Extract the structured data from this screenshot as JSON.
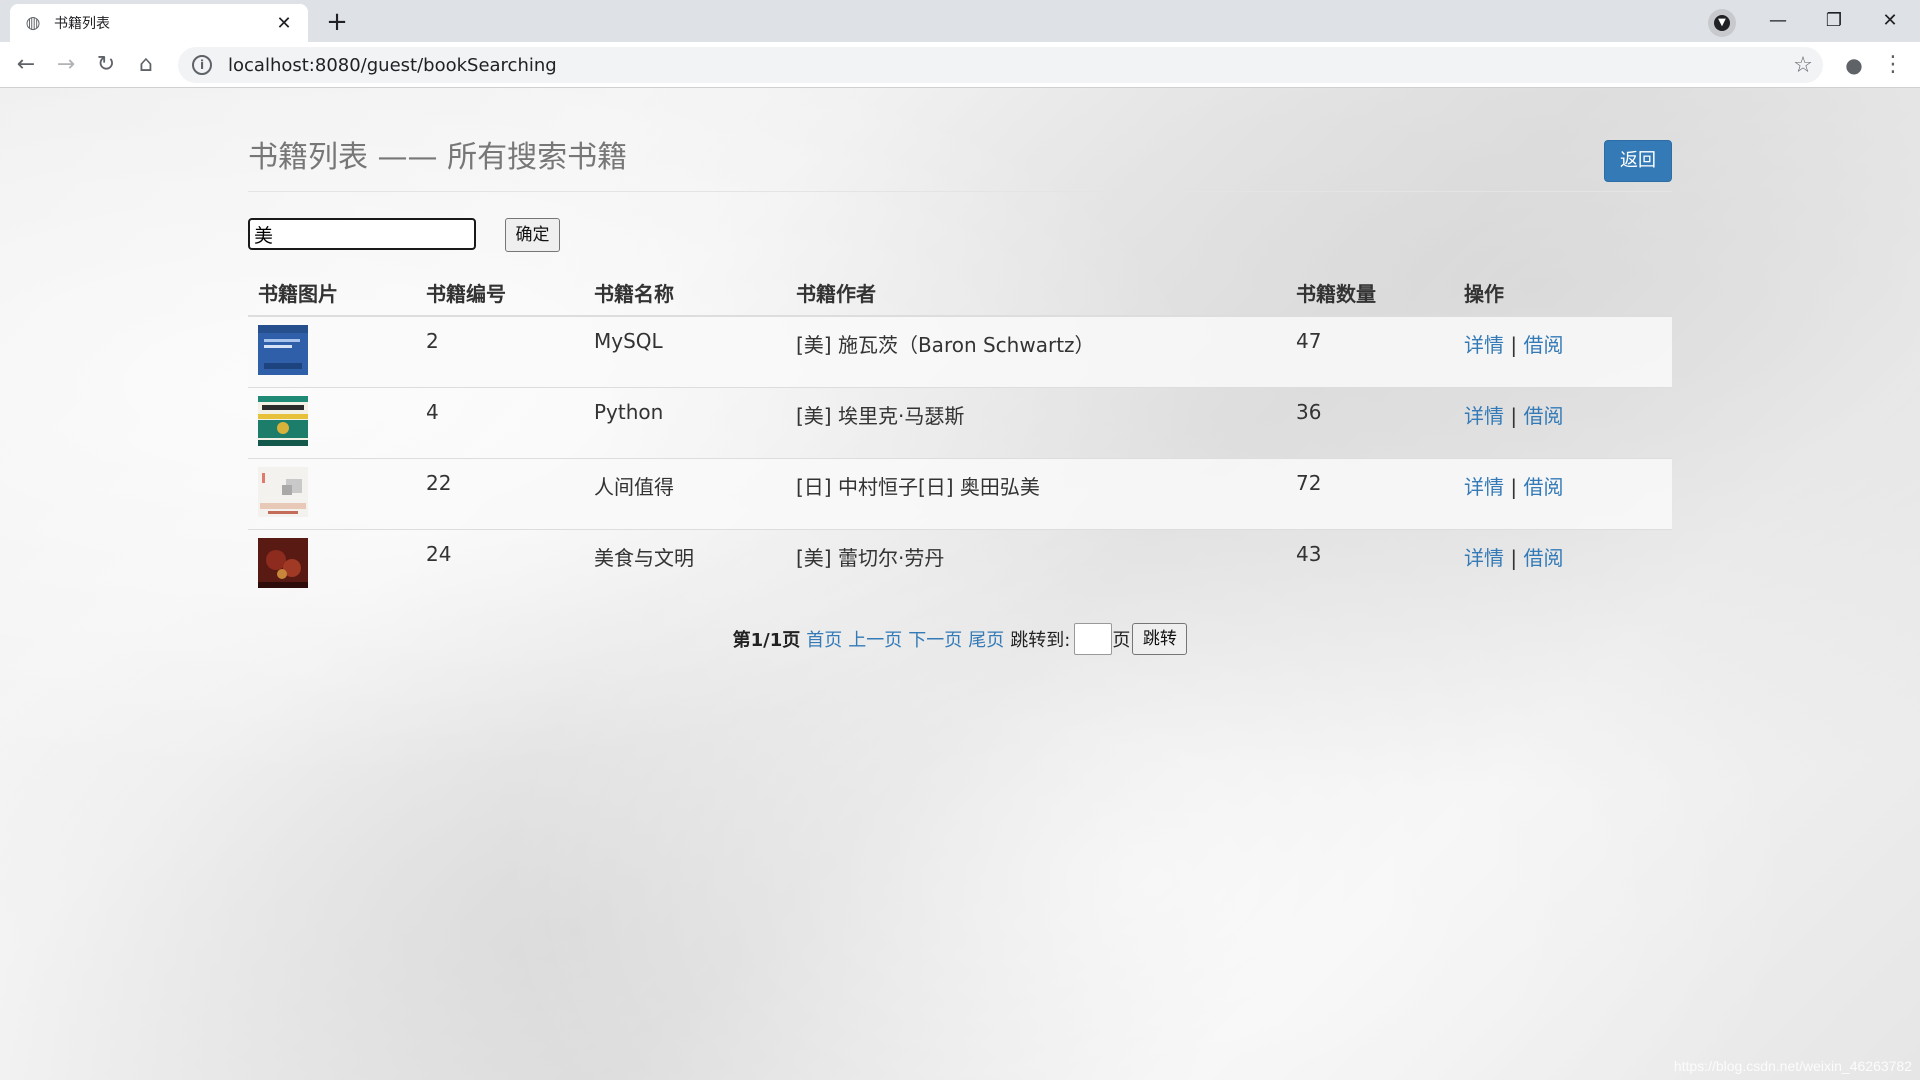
{
  "browser": {
    "tab_title": "书籍列表",
    "url": "localhost:8080/guest/bookSearching"
  },
  "header": {
    "title": "书籍列表 —— 所有搜索书籍",
    "back_label": "返回"
  },
  "search": {
    "value": "美",
    "confirm_label": "确定"
  },
  "table": {
    "columns": [
      "书籍图片",
      "书籍编号",
      "书籍名称",
      "书籍作者",
      "书籍数量",
      "操作"
    ],
    "rows": [
      {
        "id": "2",
        "name": "MySQL",
        "author": "[美] 施瓦茨（Baron Schwartz）",
        "count": "47",
        "detail": "详情",
        "sep": "|",
        "borrow": "借阅"
      },
      {
        "id": "4",
        "name": "Python",
        "author": "[美] 埃里克·马瑟斯",
        "count": "36",
        "detail": "详情",
        "sep": "|",
        "borrow": "借阅"
      },
      {
        "id": "22",
        "name": "人间值得",
        "author": "[日] 中村恒子[日] 奥田弘美",
        "count": "72",
        "detail": "详情",
        "sep": "|",
        "borrow": "借阅"
      },
      {
        "id": "24",
        "name": "美食与文明",
        "author": "[美] 蕾切尔·劳丹",
        "count": "43",
        "detail": "详情",
        "sep": "|",
        "borrow": "借阅"
      }
    ]
  },
  "pager": {
    "current": "第1/1页",
    "first": "首页",
    "prev": "上一页",
    "next": "下一页",
    "last": "尾页",
    "jump_label": "跳转到:",
    "page_unit": "页",
    "jump_btn": "跳转"
  },
  "watermark": "https://blog.csdn.net/weixin_46263782"
}
